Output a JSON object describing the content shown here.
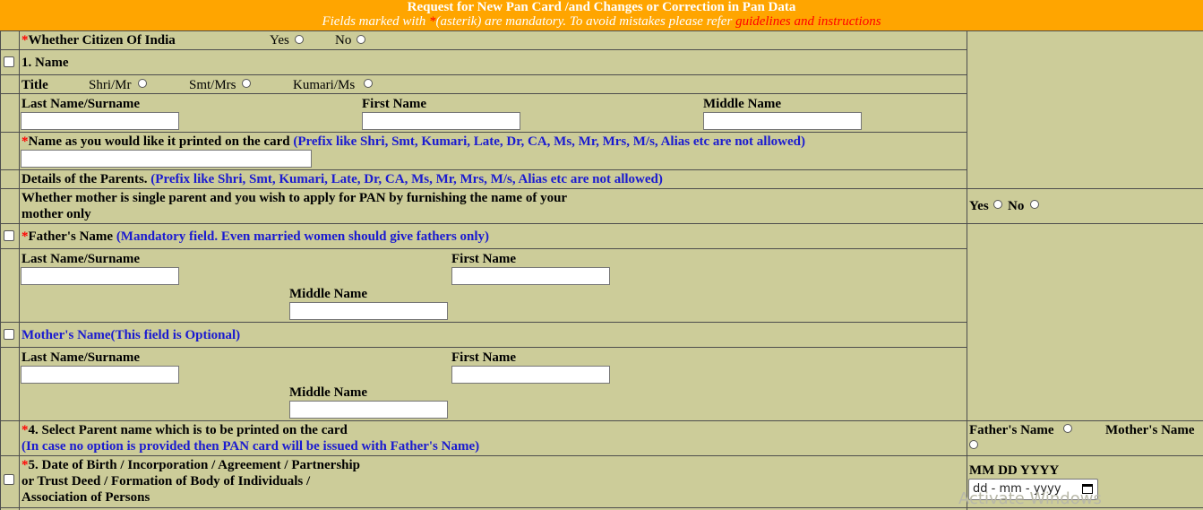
{
  "header": {
    "title": "Request for New Pan Card /and Changes or Correction in Pan Data",
    "subtitle_pre": "Fields marked with ",
    "subtitle_star": "*",
    "subtitle_mid": "(asterik) are mandatory. To avoid mistakes please refer ",
    "subtitle_link": "guidelines and instructions"
  },
  "citizen": {
    "star": "*",
    "label": "Whether Citizen Of India",
    "yes": "Yes",
    "no": "No"
  },
  "name_section": {
    "label": "1. Name"
  },
  "title_row": {
    "label": "Title",
    "opt1": "Shri/Mr",
    "opt2": "Smt/Mrs",
    "opt3": "Kumari/Ms"
  },
  "name_fields": {
    "last": "Last Name/Surname",
    "first": "First Name",
    "middle": "Middle Name"
  },
  "printed_name": {
    "star": "*",
    "label": "Name as you would like it printed on the card ",
    "note": "(Prefix like Shri, Smt, Kumari, Late, Dr, CA, Ms, Mr, Mrs, M/s, Alias etc are not allowed)"
  },
  "parents": {
    "label": "Details of the Parents. ",
    "note": "(Prefix like Shri, Smt, Kumari, Late, Dr, CA, Ms, Mr, Mrs, M/s, Alias etc are not allowed)"
  },
  "single_parent": {
    "line1": "Whether mother is single parent and you wish to apply for PAN by furnishing the name of your",
    "line2": "mother only",
    "yes": "Yes",
    "no": "No"
  },
  "father": {
    "star": "*",
    "label": "Father's Name ",
    "note": "(Mandatory field. Even married women should give fathers only)",
    "last": "Last Name/Surname",
    "first": "First Name",
    "middle": "Middle Name"
  },
  "mother": {
    "label": "Mother's Name(This field is Optional)",
    "last": "Last Name/Surname",
    "first": "First Name",
    "middle": "Middle Name"
  },
  "parent_select": {
    "star": "*",
    "label": "4. Select Parent name which is to be printed on the card",
    "note": "(In case no option is provided then PAN card will be issued with Father's Name)",
    "father": "Father's Name",
    "mother": "Mother's Name"
  },
  "dob": {
    "star": "*",
    "line1": "5. Date of Birth / Incorporation / Agreement / Partnership",
    "line2": "or Trust Deed / Formation of Body of Individuals /",
    "line3": "Association of Persons",
    "format": "MM DD YYYY",
    "placeholder": "dd - mm - yyyy"
  },
  "watermark": "Activate Windows"
}
